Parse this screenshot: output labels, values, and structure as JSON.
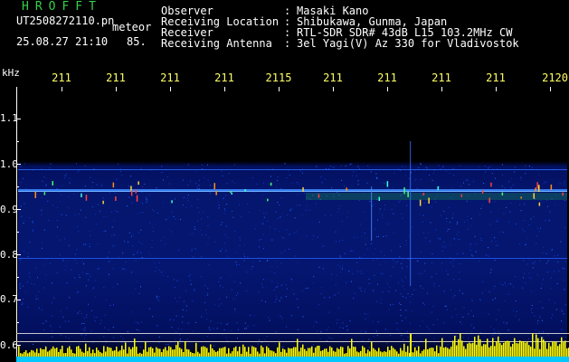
{
  "header": {
    "brand": "HROFFT",
    "filename": "UT2508272110.pn",
    "meteor_label": "meteor",
    "datetime": "25.08.27 21:10",
    "count": "85.",
    "info": [
      {
        "label": "Observer",
        "value": "Masaki Kano"
      },
      {
        "label": "Receiving Location",
        "value": "Shibukawa, Gunma, Japan"
      },
      {
        "label": "Receiver",
        "value": "RTL-SDR SDR# 43dB L15 103.2MHz CW"
      },
      {
        "label": "Receiving Antenna",
        "value": "3el Yagi(V) Az 330 for Vladivostok"
      }
    ]
  },
  "axes": {
    "y_unit": "kHz",
    "y_ticks": [
      "1.1",
      "1.0",
      "0.9",
      "0.8",
      "0.7",
      "0.6"
    ],
    "x_ticks": [
      "211",
      "211",
      "211",
      "211",
      "2115",
      "211",
      "211",
      "211",
      "211",
      "2120"
    ]
  },
  "colors": {
    "header_green": "#35d14b",
    "x_label_yellow": "#ffff66",
    "background": "#000000",
    "waterfall_blue": "#0a2aa0",
    "histogram_cyan": "#00c8ff",
    "histogram_yellow": "#ffff00"
  },
  "icons": [
    "spectrogram-waterfall",
    "echo-count-histogram"
  ]
}
